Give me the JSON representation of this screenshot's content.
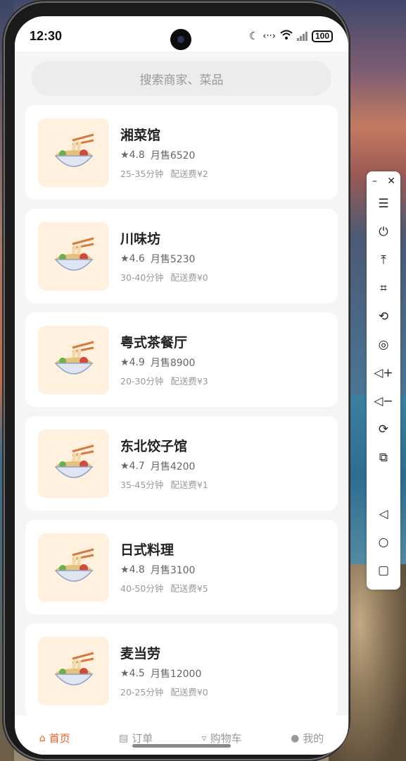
{
  "status_bar": {
    "time": "12:30",
    "battery": "100"
  },
  "search": {
    "placeholder": "搜索商家、菜品"
  },
  "restaurants": [
    {
      "name": "湘菜馆",
      "rating": "4.8",
      "sales": "月售6520",
      "time": "25-35分钟",
      "fee": "配送费¥2"
    },
    {
      "name": "川味坊",
      "rating": "4.6",
      "sales": "月售5230",
      "time": "30-40分钟",
      "fee": "配送费¥0"
    },
    {
      "name": "粤式茶餐厅",
      "rating": "4.9",
      "sales": "月售8900",
      "time": "20-30分钟",
      "fee": "配送费¥3"
    },
    {
      "name": "东北饺子馆",
      "rating": "4.7",
      "sales": "月售4200",
      "time": "35-45分钟",
      "fee": "配送费¥1"
    },
    {
      "name": "日式料理",
      "rating": "4.8",
      "sales": "月售3100",
      "time": "40-50分钟",
      "fee": "配送费¥5"
    },
    {
      "name": "麦当劳",
      "rating": "4.5",
      "sales": "月售12000",
      "time": "20-25分钟",
      "fee": "配送费¥0"
    }
  ],
  "tabs": [
    {
      "label": "首页",
      "icon": "home-icon",
      "active": true
    },
    {
      "label": "订单",
      "icon": "clipboard-icon",
      "active": false
    },
    {
      "label": "购物车",
      "icon": "cart-icon",
      "active": false
    },
    {
      "label": "我的",
      "icon": "user-icon",
      "active": false
    }
  ],
  "side_panel": {
    "icons": [
      "menu-icon",
      "power-icon",
      "pin-top-icon",
      "crop-icon",
      "rotate-icon",
      "screenshot-icon",
      "volume-up-icon",
      "volume-down-icon",
      "rotate-device-icon",
      "multi-screen-icon",
      "back-icon",
      "home-icon",
      "recents-icon"
    ]
  },
  "colors": {
    "accent": "#ff5a1f",
    "thumb_bg": "#fff1de",
    "background": "#f5f5f5"
  }
}
